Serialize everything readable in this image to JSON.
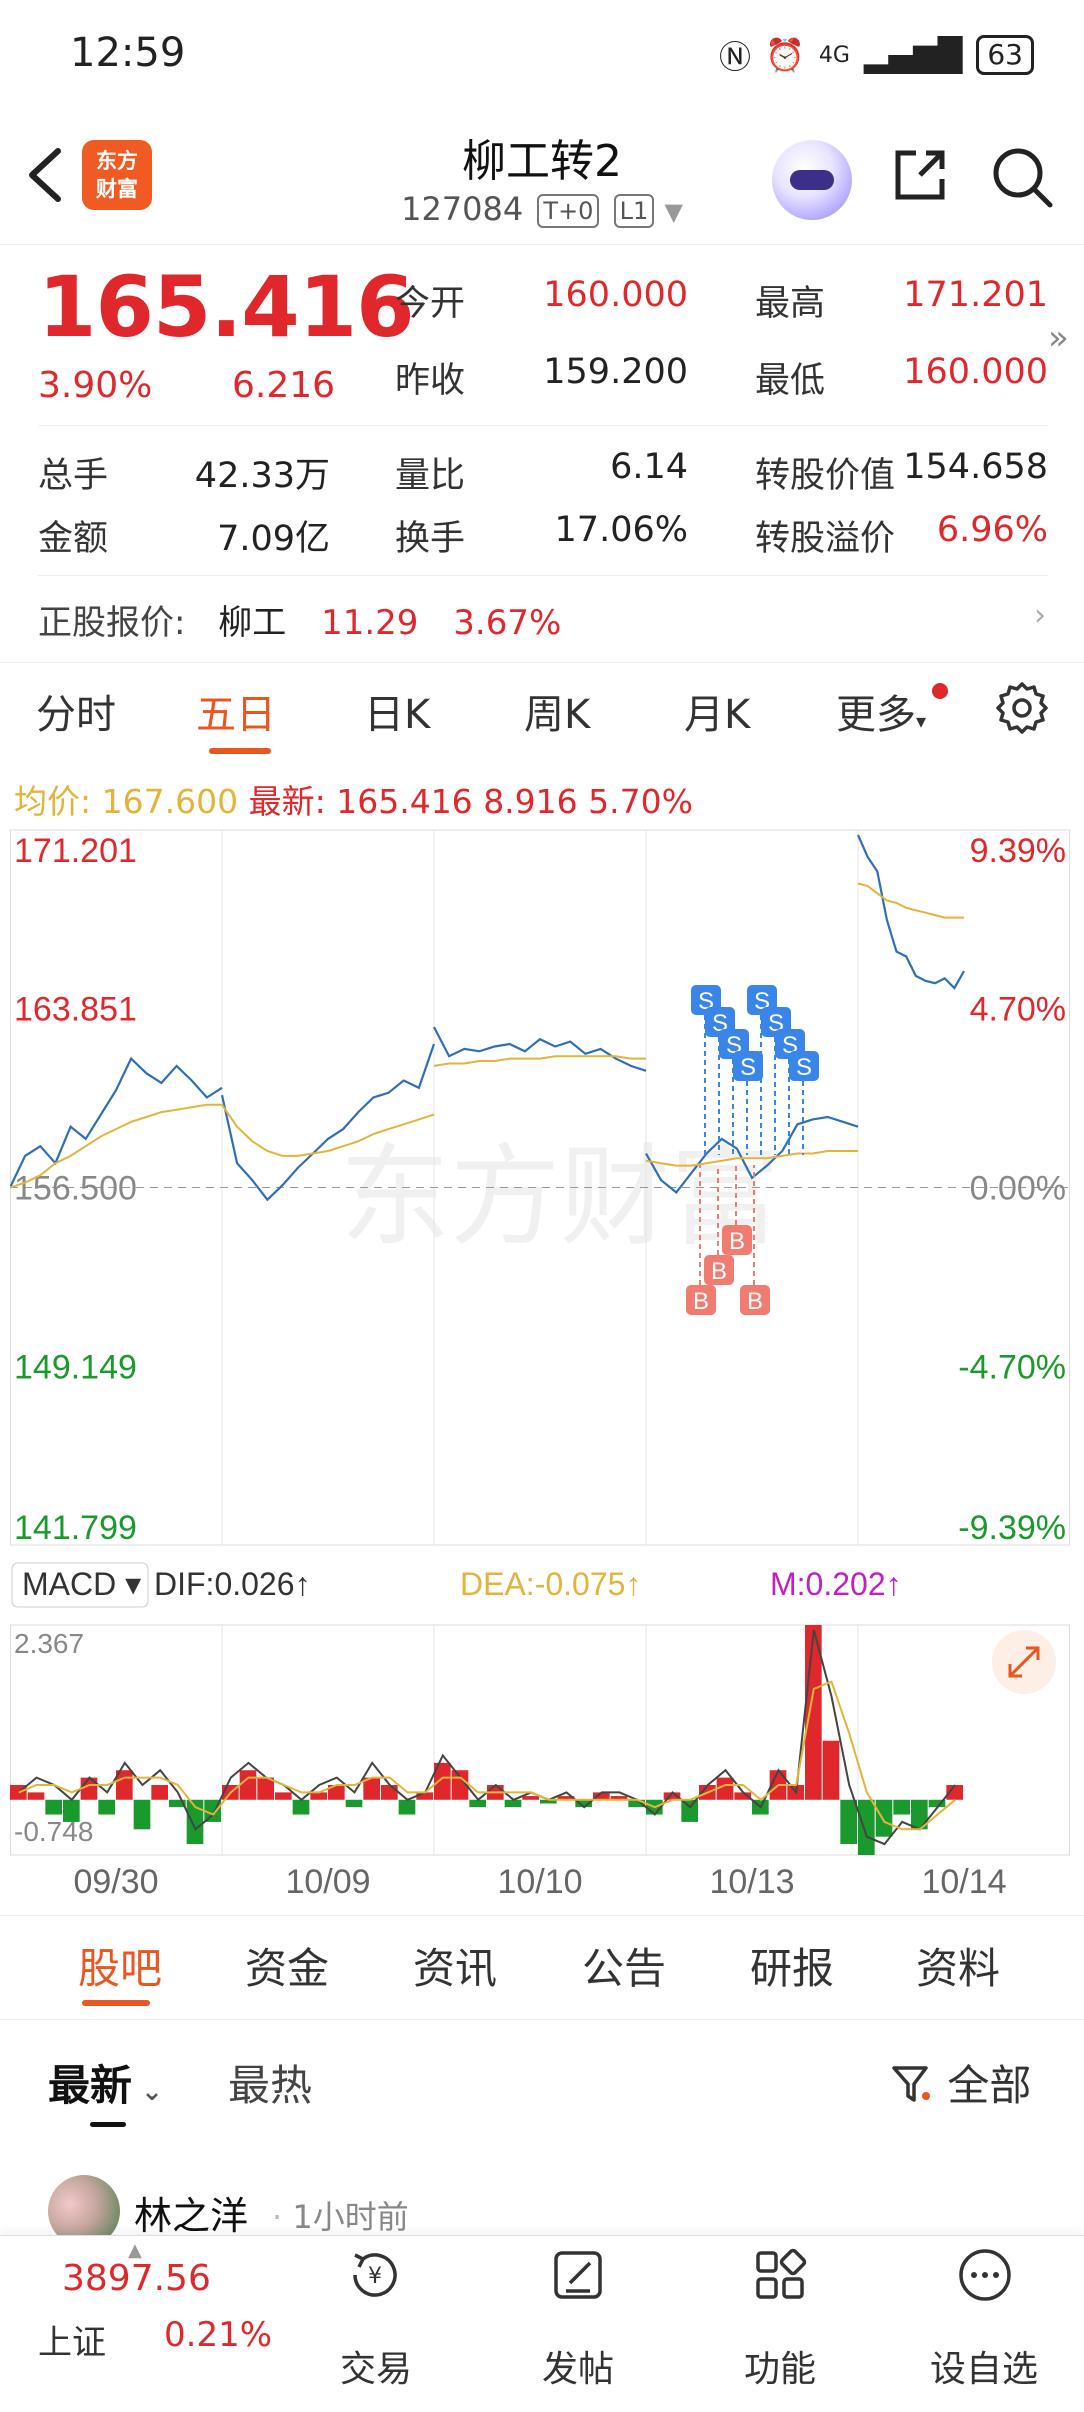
{
  "status": {
    "time": "12:59",
    "network": "4G",
    "battery": "63"
  },
  "header": {
    "title": "柳工转2",
    "code": "127084",
    "tags": [
      "T+0",
      "L1"
    ],
    "logo_text": [
      "东方",
      "财富"
    ]
  },
  "quote": {
    "price": "165.416",
    "pct": "3.90%",
    "change": "6.216",
    "stats": [
      {
        "label": "今开",
        "value": "160.000"
      },
      {
        "label": "最高",
        "value": "171.201"
      },
      {
        "label": "昨收",
        "value": "159.200"
      },
      {
        "label": "最低",
        "value": "160.000"
      },
      {
        "label": "总手",
        "value": "42.33万"
      },
      {
        "label": "量比",
        "value": "6.14"
      },
      {
        "label": "转股价值",
        "value": "154.658"
      },
      {
        "label": "金额",
        "value": "7.09亿"
      },
      {
        "label": "换手",
        "value": "17.06%"
      },
      {
        "label": "转股溢价",
        "value": "6.96%"
      }
    ],
    "underlying": {
      "label": "正股报价:",
      "name": "柳工",
      "price": "11.29",
      "pct": "3.67%"
    }
  },
  "tabs": [
    "分时",
    "五日",
    "日K",
    "周K",
    "月K",
    "更多"
  ],
  "active_tab": "五日",
  "avg_line": {
    "avg_label": "均价:",
    "avg_value": "167.600",
    "last_label": "最新:",
    "last_value": "165.416",
    "last_change": "8.916",
    "last_pct": "5.70%"
  },
  "chart_data": {
    "type": "line",
    "y_left_ticks": [
      "171.201",
      "163.851",
      "156.500",
      "149.149",
      "141.799"
    ],
    "y_right_ticks": [
      "9.39%",
      "4.70%",
      "0.00%",
      "-4.70%",
      "-9.39%"
    ],
    "x_labels": [
      "09/30",
      "10/09",
      "10/10",
      "10/13",
      "10/14"
    ],
    "ylim": [
      141.799,
      171.201
    ],
    "base": 156.5,
    "series": [
      {
        "values": [
          [
            156.5,
            157.8,
            158.2,
            157.5,
            159.0,
            158.5,
            159.5,
            160.5,
            161.8,
            161.2,
            160.8,
            161.5,
            160.9,
            160.2,
            160.6
          ],
          [
            160.3,
            157.5,
            156.8,
            156.0,
            156.6,
            157.3,
            157.9,
            158.5,
            158.9,
            159.6,
            160.2,
            160.4,
            160.9,
            160.6,
            162.4
          ],
          [
            163.1,
            161.9,
            162.2,
            162.1,
            162.3,
            162.4,
            162.1,
            162.6,
            162.3,
            162.5,
            162.0,
            162.2,
            161.8,
            161.5,
            161.3
          ],
          [
            157.9,
            156.8,
            156.3,
            157.1,
            157.9,
            158.5,
            158.1,
            156.9,
            157.4,
            158.0,
            159.1,
            159.3,
            159.4,
            159.2,
            159.0
          ],
          [
            171.0,
            170.1,
            169.5,
            167.5,
            166.2,
            166.0,
            165.2,
            165.0,
            164.9,
            165.1,
            164.7,
            165.4
          ]
        ]
      },
      {
        "values": [
          [
            156.5,
            156.7,
            157.0,
            157.5,
            157.8,
            158.2,
            158.6,
            158.9,
            159.2,
            159.4,
            159.6,
            159.7,
            159.8,
            159.9,
            159.9
          ],
          [
            159.9,
            159.0,
            158.4,
            158.0,
            157.8,
            157.8,
            157.9,
            158.0,
            158.2,
            158.4,
            158.7,
            158.9,
            159.1,
            159.3,
            159.5
          ],
          [
            161.5,
            161.6,
            161.6,
            161.7,
            161.7,
            161.8,
            161.8,
            161.8,
            161.9,
            161.9,
            161.9,
            161.9,
            161.9,
            161.8,
            161.8
          ],
          [
            157.6,
            157.5,
            157.4,
            157.4,
            157.5,
            157.6,
            157.7,
            157.7,
            157.7,
            157.8,
            157.9,
            157.9,
            158.0,
            158.0,
            158.0
          ],
          [
            169.0,
            168.9,
            168.6,
            168.3,
            168.2,
            168.0,
            167.9,
            167.8,
            167.7,
            167.6,
            167.6,
            167.6
          ]
        ]
      }
    ],
    "trade_marks": [
      "S",
      "S",
      "S",
      "S",
      "S",
      "S",
      "S",
      "S",
      "B",
      "B",
      "B",
      "B"
    ],
    "macd": {
      "labels": {
        "name": "MACD",
        "dif": "DIF:0.026",
        "dea": "DEA:-0.075",
        "m": "M:0.202"
      },
      "ylim": [
        -0.748,
        2.367
      ],
      "bars": [
        0.2,
        0.1,
        -0.2,
        -0.3,
        0.3,
        -0.2,
        0.4,
        -0.4,
        0.2,
        -0.1,
        -0.6,
        -0.3,
        0.2,
        0.4,
        0.3,
        0.1,
        -0.2,
        0.1,
        0.2,
        -0.1,
        0.3,
        0.2,
        -0.2,
        0.1,
        0.5,
        0.4,
        -0.1,
        0.2,
        -0.1,
        0.05,
        -0.05,
        0.05,
        -0.1,
        0.1,
        0.05,
        -0.1,
        -0.2,
        0.1,
        -0.3,
        0.2,
        0.3,
        0.1,
        -0.2,
        0.4,
        0.2,
        2.367,
        0.8,
        -0.6,
        -0.748,
        -0.5,
        -0.2,
        -0.4,
        -0.1,
        0.2
      ],
      "dif": [
        0.1,
        0.3,
        0.2,
        0.0,
        0.3,
        0.1,
        0.5,
        0.2,
        0.4,
        0.1,
        -0.4,
        -0.2,
        0.3,
        0.5,
        0.3,
        0.2,
        0.0,
        0.2,
        0.3,
        0.1,
        0.5,
        0.2,
        0.0,
        0.1,
        0.6,
        0.3,
        0.0,
        0.2,
        0.0,
        0.1,
        0.0,
        0.1,
        -0.1,
        0.1,
        0.1,
        0.0,
        -0.2,
        0.1,
        -0.1,
        0.2,
        0.4,
        0.1,
        -0.1,
        0.4,
        0.1,
        2.3,
        1.4,
        0.2,
        -0.5,
        -0.6,
        -0.3,
        -0.4,
        -0.1,
        0.2
      ],
      "dea": [
        0.1,
        0.2,
        0.2,
        0.1,
        0.2,
        0.2,
        0.3,
        0.3,
        0.3,
        0.2,
        -0.1,
        -0.2,
        0.1,
        0.3,
        0.3,
        0.2,
        0.1,
        0.1,
        0.2,
        0.2,
        0.3,
        0.3,
        0.1,
        0.1,
        0.3,
        0.3,
        0.1,
        0.1,
        0.1,
        0.1,
        0.0,
        0.0,
        0.0,
        0.0,
        0.0,
        0.0,
        -0.1,
        0.0,
        0.0,
        0.1,
        0.2,
        0.2,
        0.0,
        0.2,
        0.2,
        1.5,
        1.6,
        0.9,
        0.1,
        -0.3,
        -0.4,
        -0.4,
        -0.2,
        0.0
      ]
    }
  },
  "bottom_tabs": [
    "股吧",
    "资金",
    "资讯",
    "公告",
    "研报",
    "资料"
  ],
  "sort": {
    "latest": "最新",
    "hot": "最热",
    "filter": "全部"
  },
  "post": {
    "name": "林之洋",
    "time": "1小时前"
  },
  "dock": {
    "index_value": "3897.56",
    "index_name": "上证",
    "index_pct": "0.21%",
    "items": [
      "交易",
      "发帖",
      "功能",
      "设自选"
    ]
  },
  "colors": {
    "accent": "#e8571f",
    "up": "#e0282c",
    "down": "#1a9a2c",
    "price_line": "#2f6fb5",
    "avg_line": "#e2b43a",
    "sell_mark": "#3a86e8",
    "buy_mark": "#f07b6f"
  }
}
